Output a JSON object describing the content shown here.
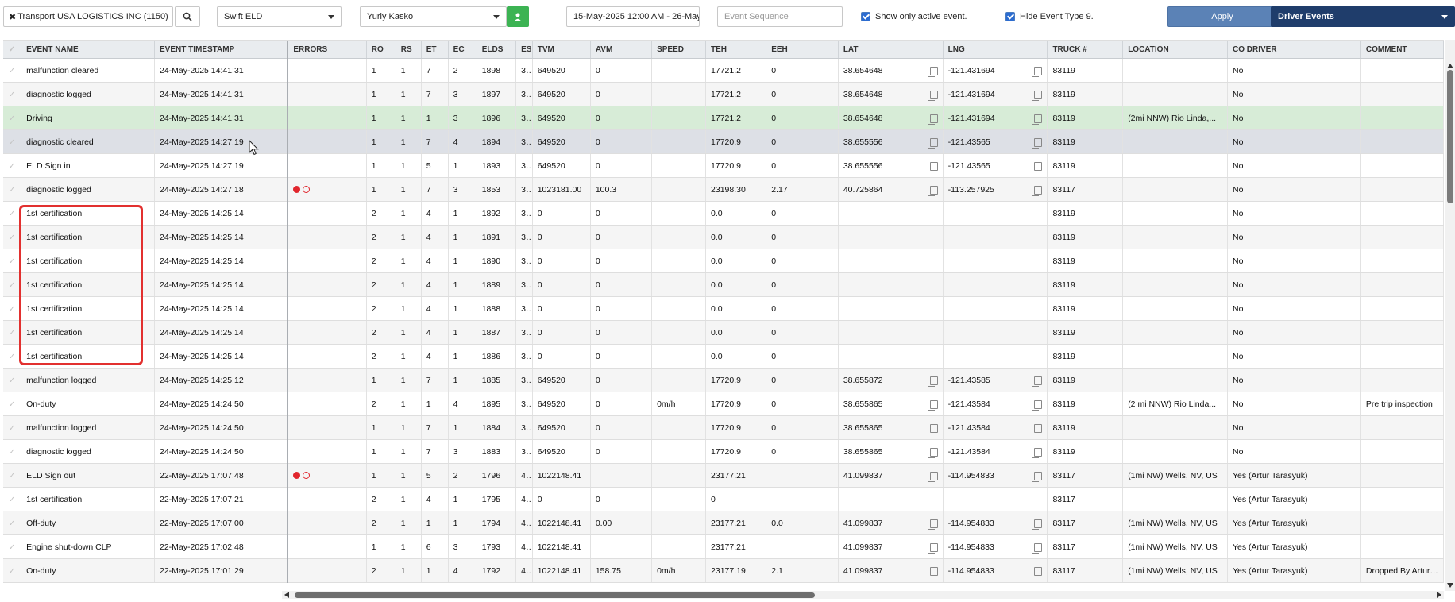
{
  "toolbar": {
    "company": "Transport USA LOGISTICS INC (1150)",
    "eld_type": "Swift ELD",
    "driver": "Yuriy Kasko",
    "date_range": "15-May-2025 12:00 AM - 26-May",
    "event_sequence_placeholder": "Event Sequence",
    "show_active_label": "Show only active event.",
    "hide_type9_label": "Hide Event Type 9.",
    "apply_label": "Apply",
    "view_select": "Driver Events",
    "colors": {
      "apply_bg": "#5b82b6",
      "view_bg": "#1f3d6b",
      "person_btn": "#3cb353"
    }
  },
  "table": {
    "columns": [
      "EVENT NAME",
      "EVENT TIMESTAMP",
      "ERRORS",
      "RO",
      "RS",
      "ET",
      "EC",
      "ELDS",
      "ES",
      "TVM",
      "AVM",
      "SPEED",
      "TEH",
      "EEH",
      "LAT",
      "LNG",
      "TRUCK #",
      "LOCATION",
      "CO DRIVER",
      "COMMENT"
    ],
    "rows": [
      {
        "name": "malfunction cleared",
        "ts": "24-May-2025 14:41:31",
        "ro": "1",
        "rs": "1",
        "et": "7",
        "ec": "2",
        "elds": "1898",
        "es": "3...",
        "tvm": "649520",
        "avm": "0",
        "speed": "",
        "teh": "17721.2",
        "eeh": "0",
        "lat": "38.654648",
        "lng": "-121.431694",
        "truck": "83119",
        "loc": "",
        "co": "No",
        "comment": ""
      },
      {
        "name": "diagnostic logged",
        "ts": "24-May-2025 14:41:31",
        "ro": "1",
        "rs": "1",
        "et": "7",
        "ec": "3",
        "elds": "1897",
        "es": "3...",
        "tvm": "649520",
        "avm": "0",
        "speed": "",
        "teh": "17721.2",
        "eeh": "0",
        "lat": "38.654648",
        "lng": "-121.431694",
        "truck": "83119",
        "loc": "",
        "co": "No",
        "comment": ""
      },
      {
        "name": "Driving",
        "ts": "24-May-2025 14:41:31",
        "ro": "1",
        "rs": "1",
        "et": "1",
        "ec": "3",
        "elds": "1896",
        "es": "3...",
        "tvm": "649520",
        "avm": "0",
        "speed": "",
        "teh": "17721.2",
        "eeh": "0",
        "lat": "38.654648",
        "lng": "-121.431694",
        "truck": "83119",
        "loc": "(2mi NNW) Rio Linda,...",
        "co": "No",
        "comment": ""
      },
      {
        "name": "diagnostic cleared",
        "ts": "24-May-2025 14:27:19",
        "ro": "1",
        "rs": "1",
        "et": "7",
        "ec": "4",
        "elds": "1894",
        "es": "3...",
        "tvm": "649520",
        "avm": "0",
        "speed": "",
        "teh": "17720.9",
        "eeh": "0",
        "lat": "38.655556",
        "lng": "-121.43565",
        "truck": "83119",
        "loc": "",
        "co": "No",
        "comment": ""
      },
      {
        "name": "ELD Sign in",
        "ts": "24-May-2025 14:27:19",
        "ro": "1",
        "rs": "1",
        "et": "5",
        "ec": "1",
        "elds": "1893",
        "es": "3...",
        "tvm": "649520",
        "avm": "0",
        "speed": "",
        "teh": "17720.9",
        "eeh": "0",
        "lat": "38.655556",
        "lng": "-121.43565",
        "truck": "83119",
        "loc": "",
        "co": "No",
        "comment": ""
      },
      {
        "name": "diagnostic logged",
        "ts": "24-May-2025 14:27:18",
        "ro": "1",
        "rs": "1",
        "et": "7",
        "ec": "3",
        "elds": "1853",
        "es": "3...",
        "tvm": "1023181.00",
        "avm": "100.3",
        "speed": "",
        "teh": "23198.30",
        "eeh": "2.17",
        "lat": "40.725864",
        "lng": "-113.257925",
        "truck": "83117",
        "loc": "",
        "co": "No",
        "comment": ""
      },
      {
        "name": "1st certification",
        "ts": "24-May-2025 14:25:14",
        "ro": "2",
        "rs": "1",
        "et": "4",
        "ec": "1",
        "elds": "1892",
        "es": "3...",
        "tvm": "0",
        "avm": "0",
        "speed": "",
        "teh": "0.0",
        "eeh": "0",
        "lat": "",
        "lng": "",
        "truck": "83119",
        "loc": "",
        "co": "No",
        "comment": ""
      },
      {
        "name": "1st certification",
        "ts": "24-May-2025 14:25:14",
        "ro": "2",
        "rs": "1",
        "et": "4",
        "ec": "1",
        "elds": "1891",
        "es": "3...",
        "tvm": "0",
        "avm": "0",
        "speed": "",
        "teh": "0.0",
        "eeh": "0",
        "lat": "",
        "lng": "",
        "truck": "83119",
        "loc": "",
        "co": "No",
        "comment": ""
      },
      {
        "name": "1st certification",
        "ts": "24-May-2025 14:25:14",
        "ro": "2",
        "rs": "1",
        "et": "4",
        "ec": "1",
        "elds": "1890",
        "es": "3...",
        "tvm": "0",
        "avm": "0",
        "speed": "",
        "teh": "0.0",
        "eeh": "0",
        "lat": "",
        "lng": "",
        "truck": "83119",
        "loc": "",
        "co": "No",
        "comment": ""
      },
      {
        "name": "1st certification",
        "ts": "24-May-2025 14:25:14",
        "ro": "2",
        "rs": "1",
        "et": "4",
        "ec": "1",
        "elds": "1889",
        "es": "3...",
        "tvm": "0",
        "avm": "0",
        "speed": "",
        "teh": "0.0",
        "eeh": "0",
        "lat": "",
        "lng": "",
        "truck": "83119",
        "loc": "",
        "co": "No",
        "comment": ""
      },
      {
        "name": "1st certification",
        "ts": "24-May-2025 14:25:14",
        "ro": "2",
        "rs": "1",
        "et": "4",
        "ec": "1",
        "elds": "1888",
        "es": "3...",
        "tvm": "0",
        "avm": "0",
        "speed": "",
        "teh": "0.0",
        "eeh": "0",
        "lat": "",
        "lng": "",
        "truck": "83119",
        "loc": "",
        "co": "No",
        "comment": ""
      },
      {
        "name": "1st certification",
        "ts": "24-May-2025 14:25:14",
        "ro": "2",
        "rs": "1",
        "et": "4",
        "ec": "1",
        "elds": "1887",
        "es": "3...",
        "tvm": "0",
        "avm": "0",
        "speed": "",
        "teh": "0.0",
        "eeh": "0",
        "lat": "",
        "lng": "",
        "truck": "83119",
        "loc": "",
        "co": "No",
        "comment": ""
      },
      {
        "name": "1st certification",
        "ts": "24-May-2025 14:25:14",
        "ro": "2",
        "rs": "1",
        "et": "4",
        "ec": "1",
        "elds": "1886",
        "es": "3...",
        "tvm": "0",
        "avm": "0",
        "speed": "",
        "teh": "0.0",
        "eeh": "0",
        "lat": "",
        "lng": "",
        "truck": "83119",
        "loc": "",
        "co": "No",
        "comment": ""
      },
      {
        "name": "malfunction logged",
        "ts": "24-May-2025 14:25:12",
        "ro": "1",
        "rs": "1",
        "et": "7",
        "ec": "1",
        "elds": "1885",
        "es": "3...",
        "tvm": "649520",
        "avm": "0",
        "speed": "",
        "teh": "17720.9",
        "eeh": "0",
        "lat": "38.655872",
        "lng": "-121.43585",
        "truck": "83119",
        "loc": "",
        "co": "No",
        "comment": ""
      },
      {
        "name": "On-duty",
        "ts": "24-May-2025 14:24:50",
        "ro": "2",
        "rs": "1",
        "et": "1",
        "ec": "4",
        "elds": "1895",
        "es": "3...",
        "tvm": "649520",
        "avm": "0",
        "speed": "0m/h",
        "teh": "17720.9",
        "eeh": "0",
        "lat": "38.655865",
        "lng": "-121.43584",
        "truck": "83119",
        "loc": "(2 mi NNW) Rio Linda...",
        "co": "No",
        "comment": "Pre trip inspection"
      },
      {
        "name": "malfunction logged",
        "ts": "24-May-2025 14:24:50",
        "ro": "1",
        "rs": "1",
        "et": "7",
        "ec": "1",
        "elds": "1884",
        "es": "3...",
        "tvm": "649520",
        "avm": "0",
        "speed": "",
        "teh": "17720.9",
        "eeh": "0",
        "lat": "38.655865",
        "lng": "-121.43584",
        "truck": "83119",
        "loc": "",
        "co": "No",
        "comment": ""
      },
      {
        "name": "diagnostic logged",
        "ts": "24-May-2025 14:24:50",
        "ro": "1",
        "rs": "1",
        "et": "7",
        "ec": "3",
        "elds": "1883",
        "es": "3...",
        "tvm": "649520",
        "avm": "0",
        "speed": "",
        "teh": "17720.9",
        "eeh": "0",
        "lat": "38.655865",
        "lng": "-121.43584",
        "truck": "83119",
        "loc": "",
        "co": "No",
        "comment": ""
      },
      {
        "name": "ELD Sign out",
        "ts": "22-May-2025 17:07:48",
        "ro": "1",
        "rs": "1",
        "et": "5",
        "ec": "2",
        "elds": "1796",
        "es": "4...",
        "tvm": "1022148.41",
        "avm": "",
        "speed": "",
        "teh": "23177.21",
        "eeh": "",
        "lat": "41.099837",
        "lng": "-114.954833",
        "truck": "83117",
        "loc": "(1mi NW) Wells, NV, US",
        "co": "Yes (Artur Tarasyuk)",
        "comment": ""
      },
      {
        "name": "1st certification",
        "ts": "22-May-2025 17:07:21",
        "ro": "2",
        "rs": "1",
        "et": "4",
        "ec": "1",
        "elds": "1795",
        "es": "4...",
        "tvm": "0",
        "avm": "0",
        "speed": "",
        "teh": "0",
        "eeh": "",
        "lat": "",
        "lng": "",
        "truck": "83117",
        "loc": "",
        "co": "Yes (Artur Tarasyuk)",
        "comment": ""
      },
      {
        "name": "Off-duty",
        "ts": "22-May-2025 17:07:00",
        "ro": "2",
        "rs": "1",
        "et": "1",
        "ec": "1",
        "elds": "1794",
        "es": "4...",
        "tvm": "1022148.41",
        "avm": "0.00",
        "speed": "",
        "teh": "23177.21",
        "eeh": "0.0",
        "lat": "41.099837",
        "lng": "-114.954833",
        "truck": "83117",
        "loc": "(1mi NW) Wells, NV, US",
        "co": "Yes (Artur Tarasyuk)",
        "comment": ""
      },
      {
        "name": "Engine shut-down CLP",
        "ts": "22-May-2025 17:02:48",
        "ro": "1",
        "rs": "1",
        "et": "6",
        "ec": "3",
        "elds": "1793",
        "es": "4...",
        "tvm": "1022148.41",
        "avm": "",
        "speed": "",
        "teh": "23177.21",
        "eeh": "",
        "lat": "41.099837",
        "lng": "-114.954833",
        "truck": "83117",
        "loc": "(1mi NW) Wells, NV, US",
        "co": "Yes (Artur Tarasyuk)",
        "comment": ""
      },
      {
        "name": "On-duty",
        "ts": "22-May-2025 17:01:29",
        "ro": "2",
        "rs": "1",
        "et": "1",
        "ec": "4",
        "elds": "1792",
        "es": "4...",
        "tvm": "1022148.41",
        "avm": "158.75",
        "speed": "0m/h",
        "teh": "23177.19",
        "eeh": "2.1",
        "lat": "41.099837",
        "lng": "-114.954833",
        "truck": "83117",
        "loc": "(1mi NW) Wells, NV, US",
        "co": "Yes (Artur Tarasyuk)",
        "comment": "Dropped By Artur Ta..."
      }
    ]
  }
}
